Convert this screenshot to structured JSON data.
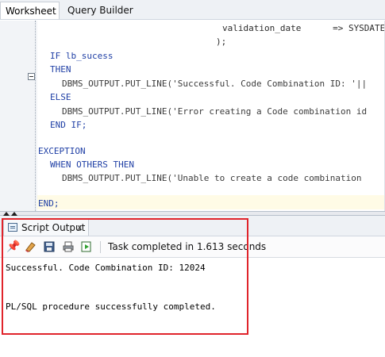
{
  "tabs": [
    {
      "label": "Worksheet"
    },
    {
      "label": "Query Builder"
    }
  ],
  "editor": {
    "lines": [
      {
        "text": "validation_date      => SYSDATE"
      },
      {
        "text": ");"
      },
      {
        "text": "IF lb_sucess"
      },
      {
        "text": "THEN"
      },
      {
        "text": "DBMS_OUTPUT.PUT_LINE('Successful. Code Combination ID: '||"
      },
      {
        "text": "ELSE"
      },
      {
        "text": "DBMS_OUTPUT.PUT_LINE('Error creating a Code combination id"
      },
      {
        "text": "END IF;"
      },
      {
        "text": "EXCEPTION"
      },
      {
        "text": "WHEN OTHERS THEN"
      },
      {
        "text": "DBMS_OUTPUT.PUT_LINE('Unable to create a code combination"
      },
      {
        "text": "END;"
      }
    ]
  },
  "output_panel": {
    "tab_label": "Script Output",
    "close_label": "x",
    "status_text": "Task completed in 1.613 seconds",
    "lines": [
      "Successful. Code Combination ID: 12024",
      "PL/SQL procedure successfully completed."
    ]
  },
  "toolbar_icons": [
    "pin-icon",
    "eraser-icon",
    "save-icon",
    "print-icon",
    "run-script-icon"
  ],
  "colors": {
    "keyword": "#1f3fa5",
    "highlight_box": "#e0242b",
    "current_line": "#fffbe6"
  }
}
